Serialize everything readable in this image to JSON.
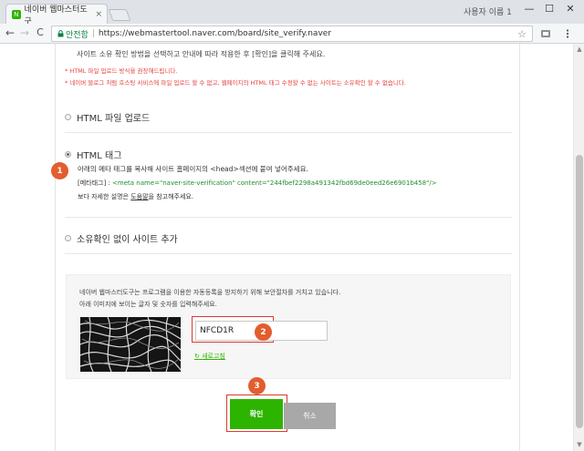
{
  "browser": {
    "tab_title": "네이버 웹마스터도구",
    "tab_close": "×",
    "user_name": "사용자 이름 1",
    "controls": {
      "minimize": "—",
      "maximize": "☐",
      "close": "✕"
    },
    "nav": {
      "back": "←",
      "forward": "→",
      "reload": "C"
    },
    "secure_label": "안전함",
    "url": "https://webmastertool.naver.com/board/site_verify.naver",
    "star": "☆"
  },
  "page": {
    "intro": "사이트 소유 확인 방법을 선택하고 안내에 따라 적용한 후 [확인]을 클릭해 주세요.",
    "notes": [
      "* HTML 파일 업로드 방식을 권장해드립니다.",
      "* 네이버 블로그 처럼 호스팅 서비스에 파일 업로드 할 수 없고, 웹페이지의 HTML 태그 수정할 수 없는 사이트는 소유확인 할 수 없습니다."
    ],
    "options": {
      "file_upload": "HTML 파일 업로드",
      "html_tag": "HTML 태그",
      "no_verify": "소유확인 없이 사이트 추가"
    },
    "html_tag_desc": "아래의 메타 태그를 복사해 사이트 홈페이지의 <head>섹션에 붙여 넣어주세요.",
    "meta_label": "[메타태그] :",
    "meta_code": "<meta name=\"naver-site-verification\" content=\"244fbef2298a491342fbd69de0eed26e6901b458\"/>",
    "help_pre": "보다 자세한 설명은",
    "help_link": "도움말",
    "help_post": "을 참고해주세요.",
    "captcha": {
      "line1": "네이버 웹마스터도구는 프로그램을 이용한 자동등록을 방지하기 위해 보안절차를 거치고 있습니다.",
      "line2": "아래 이미지에 보이는 글자 및 숫자를 입력해주세요.",
      "input_value": "NFCD1R",
      "refresh": "새로고침",
      "refresh_icon": "↻"
    },
    "buttons": {
      "confirm": "확인",
      "cancel": "취소"
    },
    "markers": [
      "1",
      "2",
      "3"
    ]
  },
  "colors": {
    "naver_green": "#2db400",
    "marker_orange": "#e35d2f",
    "highlight_red": "#d83a2e",
    "note_red": "#e6423d",
    "code_green": "#1e8f2e"
  },
  "icons": {
    "favicon": "naver-green-square-icon",
    "lock": "lock-icon",
    "bookmark": "star-icon",
    "extensions": [
      "extension-icon",
      "menu-dots-icon"
    ]
  }
}
